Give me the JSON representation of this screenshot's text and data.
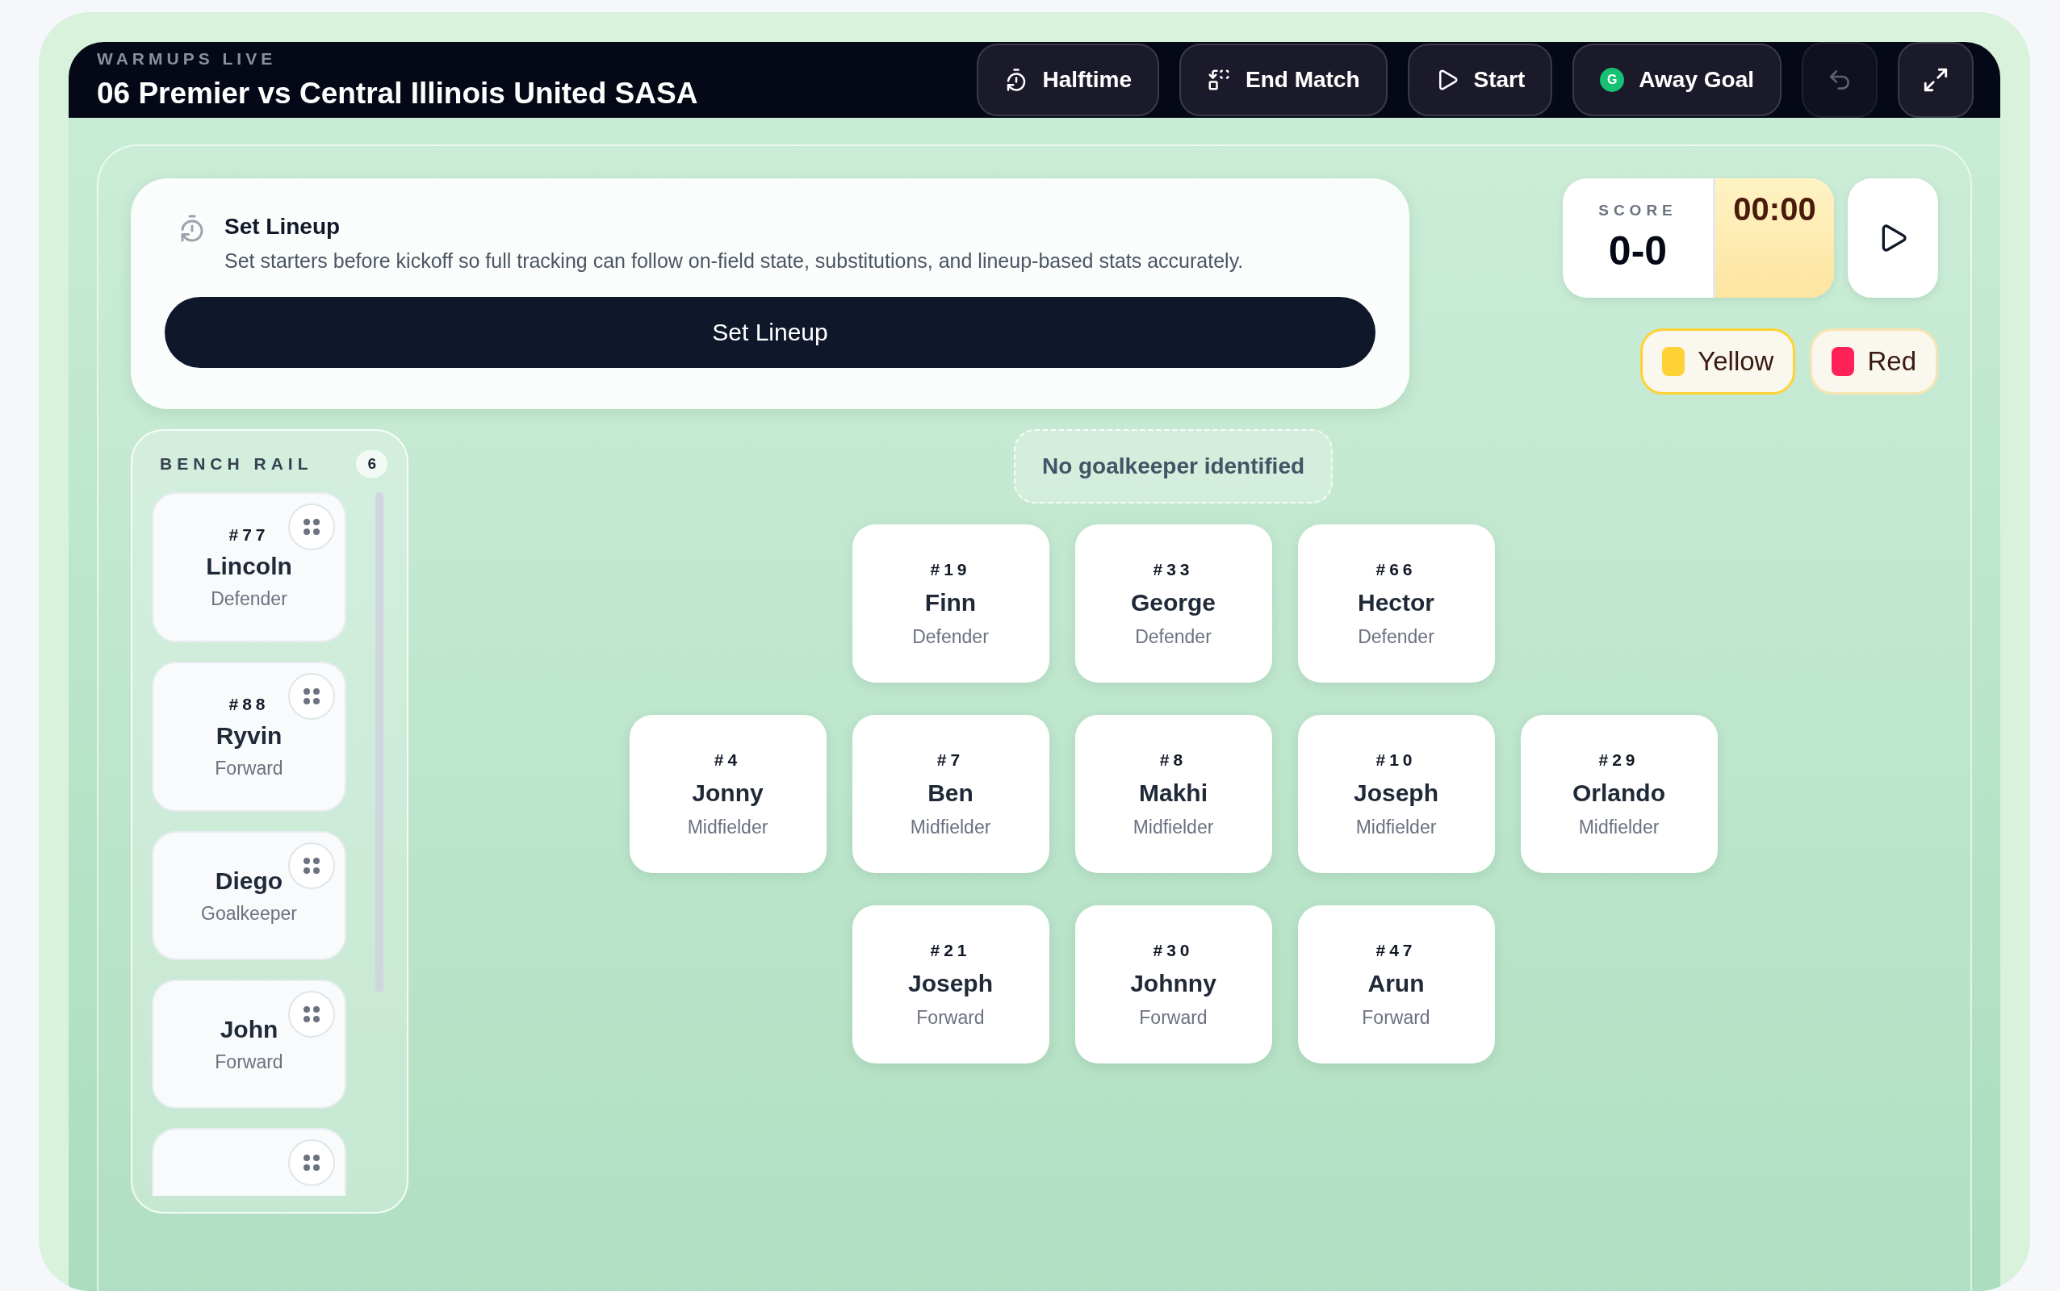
{
  "header": {
    "eyebrow": "WARMUPS LIVE",
    "title": "06 Premier vs Central Illinois United SASA",
    "actions": [
      {
        "kind": "halftime",
        "label": "Halftime"
      },
      {
        "kind": "end",
        "label": "End Match"
      },
      {
        "kind": "start",
        "label": "Start"
      },
      {
        "kind": "goal",
        "label": "Away Goal",
        "badge": "G"
      }
    ],
    "undo": {
      "disabled": true
    }
  },
  "lineup_prompt": {
    "title": "Set Lineup",
    "description": "Set starters before kickoff so full tracking can follow on-field state, substitutions, and lineup-based stats accurately.",
    "button": "Set Lineup"
  },
  "score": {
    "label": "SCORE",
    "value": "0-0",
    "clock": "00:00"
  },
  "card_buttons": [
    {
      "label": "Yellow",
      "color": "#ffd233",
      "selected": true
    },
    {
      "label": "Red",
      "color": "#ff2257",
      "selected": false
    }
  ],
  "bench": {
    "title": "BENCH RAIL",
    "count": "6",
    "players": [
      {
        "kind": "player",
        "number": "#77",
        "name": "Lincoln",
        "role": "Defender"
      },
      {
        "kind": "player",
        "number": "#88",
        "name": "Ryvin",
        "role": "Forward"
      },
      {
        "kind": "player",
        "name": "Diego",
        "role": "Goalkeeper"
      },
      {
        "kind": "player",
        "name": "John",
        "role": "Forward"
      },
      {
        "kind": "peek"
      }
    ]
  },
  "notice": "No goalkeeper identified",
  "formation": [
    {
      "players": [
        {
          "number": "#19",
          "name": "Finn",
          "role": "Defender"
        },
        {
          "number": "#33",
          "name": "George",
          "role": "Defender"
        },
        {
          "number": "#66",
          "name": "Hector",
          "role": "Defender"
        }
      ]
    },
    {
      "players": [
        {
          "number": "#4",
          "name": "Jonny",
          "role": "Midfielder"
        },
        {
          "number": "#7",
          "name": "Ben",
          "role": "Midfielder"
        },
        {
          "number": "#8",
          "name": "Makhi",
          "role": "Midfielder"
        },
        {
          "number": "#10",
          "name": "Joseph",
          "role": "Midfielder"
        },
        {
          "number": "#29",
          "name": "Orlando",
          "role": "Midfielder"
        }
      ]
    },
    {
      "players": [
        {
          "number": "#21",
          "name": "Joseph",
          "role": "Forward"
        },
        {
          "number": "#30",
          "name": "Johnny",
          "role": "Forward"
        },
        {
          "number": "#47",
          "name": "Arun",
          "role": "Forward"
        }
      ]
    }
  ]
}
